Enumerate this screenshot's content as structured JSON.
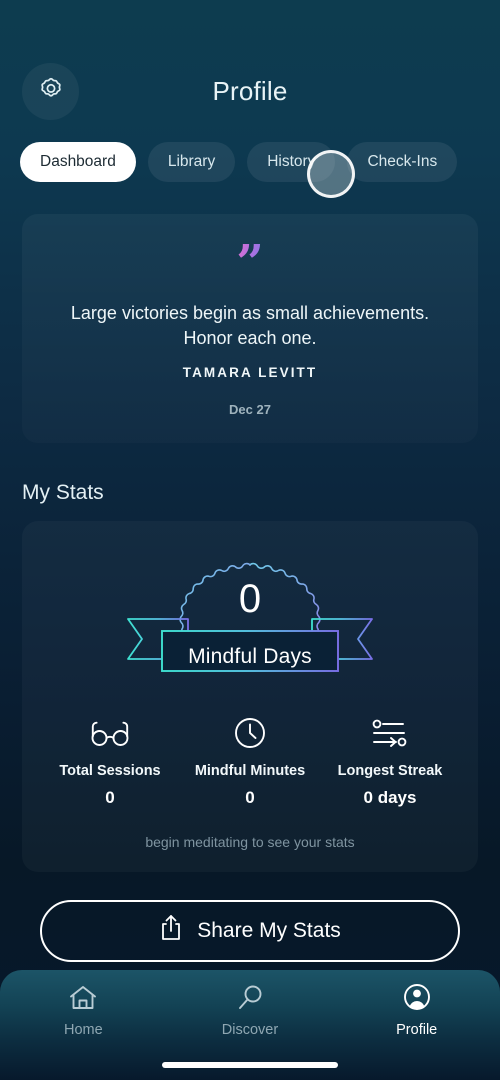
{
  "header": {
    "title": "Profile",
    "settings_icon": "gear-icon"
  },
  "tabs": [
    {
      "label": "Dashboard",
      "active": true
    },
    {
      "label": "Library",
      "active": false
    },
    {
      "label": "History",
      "active": false
    },
    {
      "label": "Check-Ins",
      "active": false
    }
  ],
  "quote_card": {
    "quote_mark": "\"",
    "text": "Large victories begin as small achievements. Honor each one.",
    "author": "TAMARA LEVITT",
    "date": "Dec 27"
  },
  "stats_section": {
    "title": "My Stats",
    "badge": {
      "number": "0",
      "ribbon_label": "Mindful Days"
    },
    "stats": [
      {
        "icon": "glasses-icon",
        "label": "Total Sessions",
        "value": "0"
      },
      {
        "icon": "clock-icon",
        "label": "Mindful Minutes",
        "value": "0"
      },
      {
        "icon": "streak-icon",
        "label": "Longest Streak",
        "value": "0 days"
      }
    ],
    "hint": "begin meditating to see your stats",
    "share_button": {
      "label": "Share My Stats",
      "icon": "share-icon"
    }
  },
  "bottom_nav": [
    {
      "icon": "home-icon",
      "label": "Home",
      "active": false
    },
    {
      "icon": "search-icon",
      "label": "Discover",
      "active": false
    },
    {
      "icon": "profile-avatar-icon",
      "label": "Profile",
      "active": true
    }
  ],
  "colors": {
    "background_top": "#0d3c4f",
    "background_bottom": "#041220",
    "accent_cyan": "#3ee0d0",
    "accent_purple": "#7b7ae8",
    "accent_pink": "#e46fd0",
    "active_tab_bg": "#ffffff",
    "nav_bar": "#1c5467"
  }
}
